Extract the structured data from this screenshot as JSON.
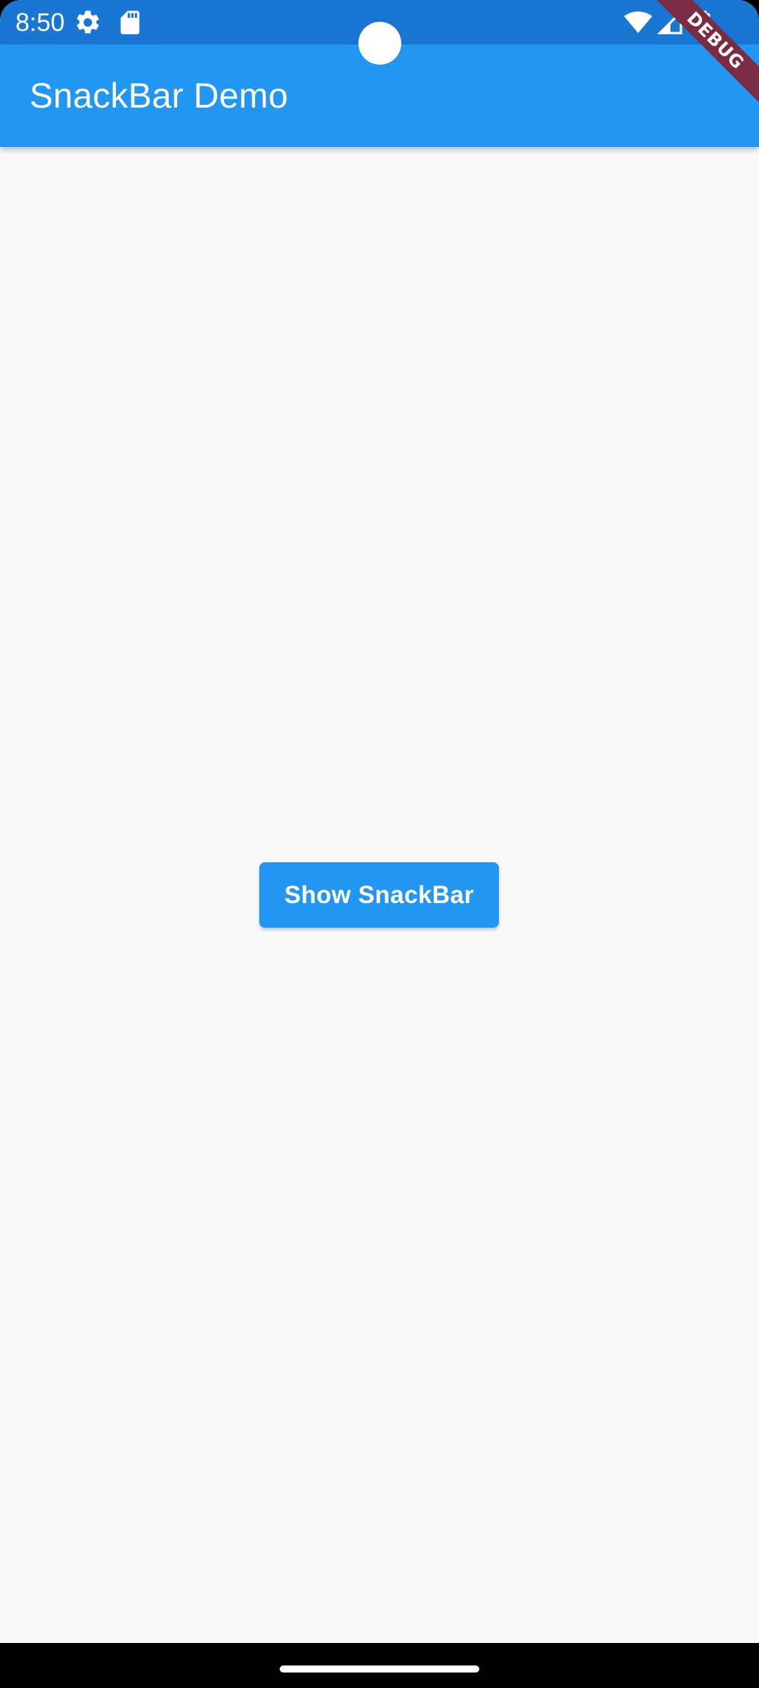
{
  "status_bar": {
    "time": "8:50",
    "left_icons": [
      "gear-icon",
      "sd-card-icon"
    ],
    "right_icons": [
      "wifi-icon",
      "cell-signal-icon",
      "battery-icon"
    ]
  },
  "debug_banner": {
    "text": "DEBUG",
    "color": "#7B2C44"
  },
  "app_bar": {
    "title": "SnackBar Demo",
    "color": "#2196F3"
  },
  "main": {
    "show_snackbar_label": "Show SnackBar"
  },
  "colors": {
    "status_bar": "#1976D2",
    "primary": "#2196F3",
    "background": "#FAFAFA"
  }
}
